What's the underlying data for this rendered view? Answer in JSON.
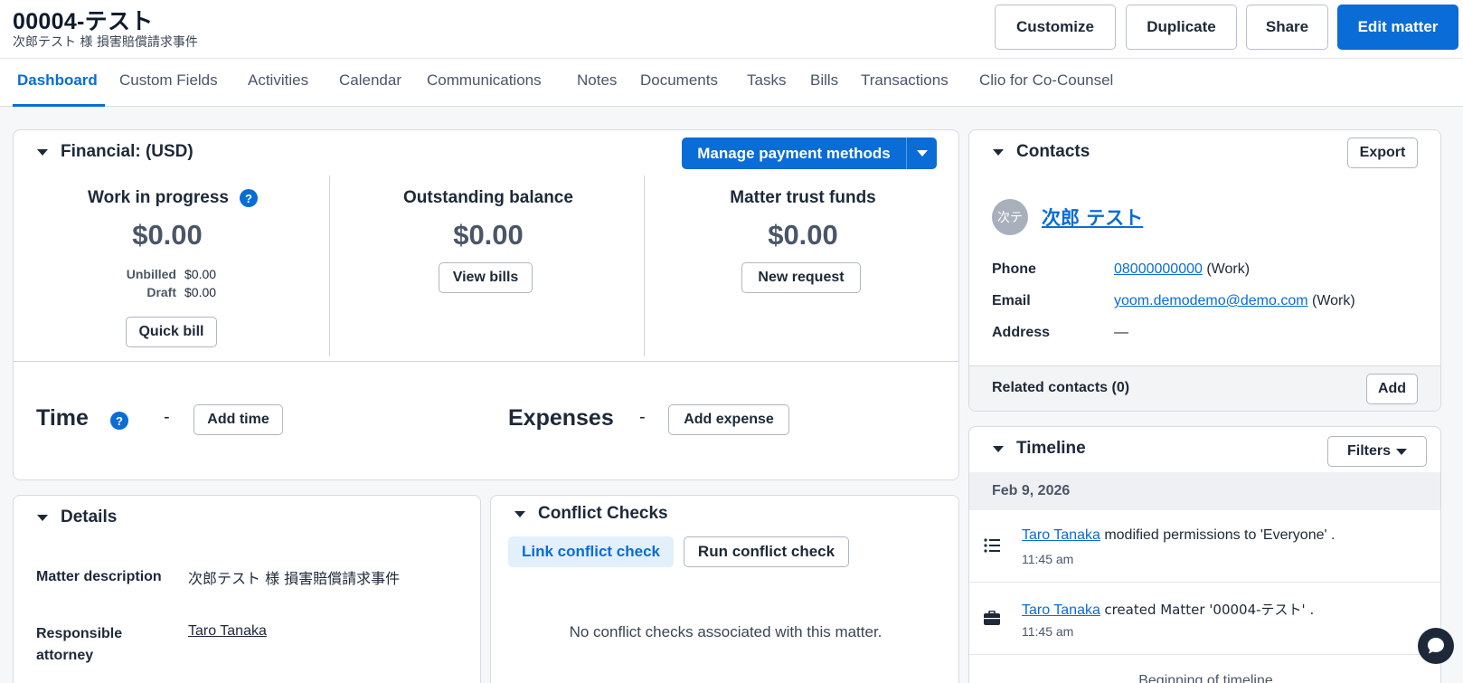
{
  "header": {
    "title": "00004-テスト",
    "subtitle": "次郎テスト 様 損害賠償請求事件",
    "buttons": {
      "customize": "Customize",
      "duplicate": "Duplicate",
      "share": "Share",
      "edit": "Edit matter"
    }
  },
  "tabs": [
    {
      "label": "Dashboard"
    },
    {
      "label": "Custom Fields"
    },
    {
      "label": "Activities"
    },
    {
      "label": "Calendar"
    },
    {
      "label": "Communications"
    },
    {
      "label": "Notes"
    },
    {
      "label": "Documents"
    },
    {
      "label": "Tasks"
    },
    {
      "label": "Bills"
    },
    {
      "label": "Transactions"
    },
    {
      "label": "Clio for Co-Counsel"
    }
  ],
  "financial": {
    "title": "Financial: (USD)",
    "manage_btn": "Manage payment methods",
    "wip": {
      "label": "Work in progress",
      "amount": "$0.00",
      "unbilled_label": "Unbilled",
      "unbilled_value": "$0.00",
      "draft_label": "Draft",
      "draft_value": "$0.00",
      "button": "Quick bill"
    },
    "outstanding": {
      "label": "Outstanding balance",
      "amount": "$0.00",
      "button": "View bills"
    },
    "trust": {
      "label": "Matter trust funds",
      "amount": "$0.00",
      "button": "New request"
    },
    "time": {
      "label": "Time",
      "dash": "-",
      "button": "Add time"
    },
    "expenses": {
      "label": "Expenses",
      "dash": "-",
      "button": "Add expense"
    }
  },
  "details": {
    "title": "Details",
    "matter_description_label": "Matter description",
    "matter_description_value": "次郎テスト 様 損害賠償請求事件",
    "responsible_attorney_label": "Responsible attorney",
    "responsible_attorney_value": "Taro Tanaka"
  },
  "conflict": {
    "title": "Conflict Checks",
    "link_btn": "Link conflict check",
    "run_btn": "Run conflict check",
    "empty": "No conflict checks associated with this matter."
  },
  "contacts": {
    "title": "Contacts",
    "export_btn": "Export",
    "avatar_initials": "次テ",
    "name": "次郎 テスト",
    "phone_label": "Phone",
    "phone_value": "08000000000",
    "phone_type": "(Work)",
    "email_label": "Email",
    "email_value": "yoom.demodemo@demo.com",
    "email_type": "(Work)",
    "address_label": "Address",
    "address_value": "—",
    "related_label": "Related contacts (0)",
    "add_btn": "Add"
  },
  "timeline": {
    "title": "Timeline",
    "filters_btn": "Filters",
    "date": "Feb 9, 2026",
    "entries": [
      {
        "user": "Taro Tanaka",
        "text": "modified permissions to 'Everyone' .",
        "time": "11:45 am",
        "icon": "list-icon"
      },
      {
        "user": "Taro Tanaka",
        "text": "created Matter '00004-テスト' .",
        "time": "11:45 am",
        "icon": "briefcase-icon"
      }
    ],
    "end": "Beginning of timeline"
  },
  "colors": {
    "primary": "#0a6cd6",
    "text": "#1d2939",
    "muted": "#4a5668",
    "background": "#f6f7f8"
  }
}
